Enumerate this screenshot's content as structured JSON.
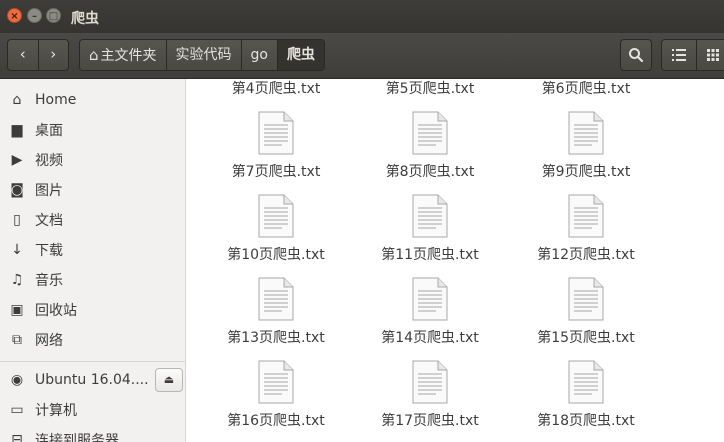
{
  "window": {
    "title": "爬虫"
  },
  "titlebar_buttons": {
    "close": "×",
    "minimize": "–",
    "maximize": "□"
  },
  "nav": {
    "back": "‹",
    "forward": "›"
  },
  "breadcrumb": [
    {
      "label": "主文件夹",
      "icon": "home-icon"
    },
    {
      "label": "实验代码"
    },
    {
      "label": "go"
    },
    {
      "label": "爬虫"
    }
  ],
  "toolbar": {
    "search_icon": "search-icon",
    "list_view_icon": "list-icon",
    "grid_view_icon": "grid-icon"
  },
  "sidebar": {
    "places": [
      {
        "label": "Home",
        "icon": "home-icon"
      },
      {
        "label": "桌面",
        "icon": "folder-icon"
      },
      {
        "label": "视频",
        "icon": "video-icon"
      },
      {
        "label": "图片",
        "icon": "camera-icon"
      },
      {
        "label": "文档",
        "icon": "document-icon"
      },
      {
        "label": "下载",
        "icon": "download-icon"
      },
      {
        "label": "音乐",
        "icon": "music-icon"
      },
      {
        "label": "回收站",
        "icon": "trash-icon"
      },
      {
        "label": "网络",
        "icon": "network-icon"
      }
    ],
    "devices": [
      {
        "label": "Ubuntu 16.04....",
        "icon": "disc-icon"
      },
      {
        "label": "计算机",
        "icon": "computer-icon"
      },
      {
        "label": "连接到服务器",
        "icon": "server-icon"
      }
    ]
  },
  "files": [
    {
      "name": "第4页爬虫.txt"
    },
    {
      "name": "第5页爬虫.txt"
    },
    {
      "name": "第6页爬虫.txt"
    },
    {
      "name": "第7页爬虫.txt"
    },
    {
      "name": "第8页爬虫.txt"
    },
    {
      "name": "第9页爬虫.txt"
    },
    {
      "name": "第10页爬虫.txt"
    },
    {
      "name": "第11页爬虫.txt"
    },
    {
      "name": "第12页爬虫.txt"
    },
    {
      "name": "第13页爬虫.txt"
    },
    {
      "name": "第14页爬虫.txt"
    },
    {
      "name": "第15页爬虫.txt"
    },
    {
      "name": "第16页爬虫.txt"
    },
    {
      "name": "第17页爬虫.txt"
    },
    {
      "name": "第18页爬虫.txt"
    }
  ],
  "colors": {
    "titlebar": "#3e3d39",
    "close_button": "#ef6a3c",
    "sidebar_bg": "#f2f1f0",
    "text": "#3c3c3c"
  }
}
